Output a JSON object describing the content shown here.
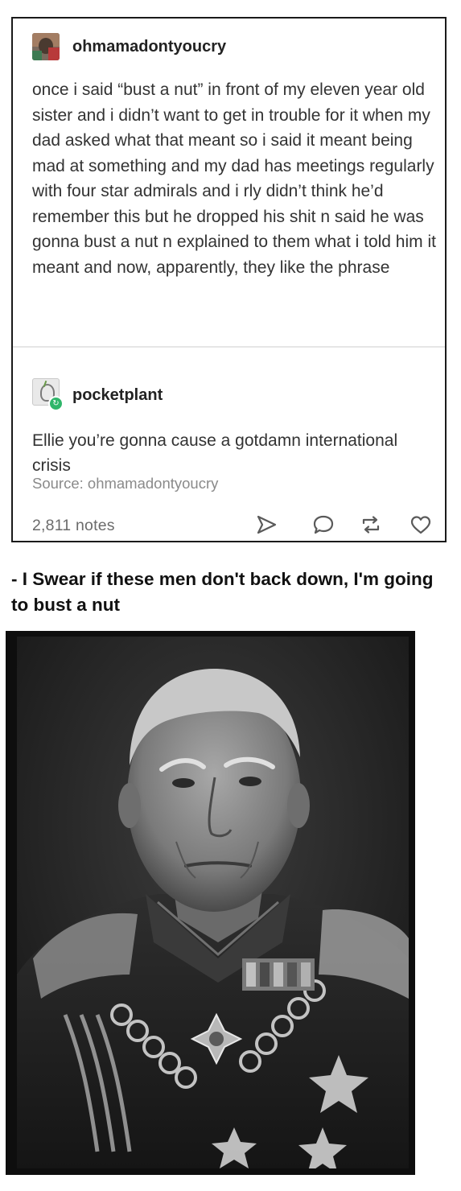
{
  "post": {
    "original": {
      "username": "ohmamadontyoucry",
      "avatar_icon": "user-avatar-icon",
      "body": "once i said “bust a nut” in front of my eleven year old sister and i didn’t want to get in trouble for it when my dad asked what that meant so i said it meant being mad at something and my dad has meetings regularly with four star admirals and i rly didn’t think he’d remember this but he dropped his shit n said he was gonna bust a nut n explained to them what i told him it meant and now, apparently, they like the phrase"
    },
    "reblog": {
      "username": "pocketplant",
      "avatar_icon": "plant-avatar-icon",
      "badge_icon": "reblog-badge-icon",
      "body": "Ellie you’re gonna cause a gotdamn international crisis"
    },
    "source_label": "Source:",
    "source_name": "ohmamadontyoucry",
    "notes": {
      "count": "2,811",
      "label": "notes"
    },
    "actions": {
      "share_icon": "share-icon",
      "reply_icon": "reply-icon",
      "reblog_icon": "reblog-icon",
      "like_icon": "heart-icon"
    }
  },
  "caption": "- I Swear if these men don't back down, I'm going to bust a nut",
  "photo": {
    "icon": "admiral-portrait-photo",
    "accent_colors": [
      "#0e0e0e",
      "#3a3a3a",
      "#9a9a9a",
      "#d8d8d8"
    ]
  }
}
